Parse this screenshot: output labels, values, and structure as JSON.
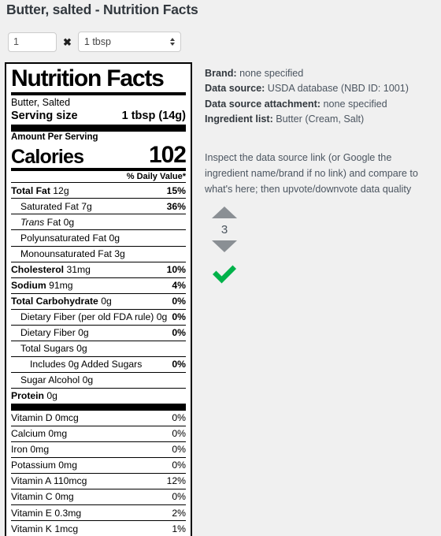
{
  "page": {
    "title": "Butter, salted - Nutrition Facts"
  },
  "serving_controls": {
    "quantity_value": "1",
    "quantity_placeholder": "1",
    "multiply_symbol": "✖",
    "unit_selected": "1 tbsp"
  },
  "label": {
    "heading": "Nutrition Facts",
    "description": "Butter, Salted",
    "serving_size_label": "Serving size",
    "serving_size_value": "1 tbsp (14g)",
    "amount_per_serving": "Amount Per Serving",
    "calories_label": "Calories",
    "calories_value": "102",
    "daily_value_header": "% Daily Value*",
    "rows": [
      {
        "name": "Total Fat",
        "amount": "12g",
        "dv": "15%",
        "bold": true,
        "indent": 0,
        "italic_word": ""
      },
      {
        "name": "Saturated Fat",
        "amount": "7g",
        "dv": "36%",
        "bold": false,
        "indent": 1,
        "italic_word": ""
      },
      {
        "name": "Trans Fat",
        "amount": "0g",
        "dv": "",
        "bold": false,
        "indent": 1,
        "italic_word": "Trans"
      },
      {
        "name": "Polyunsaturated Fat",
        "amount": "0g",
        "dv": "",
        "bold": false,
        "indent": 1,
        "italic_word": ""
      },
      {
        "name": "Monounsaturated Fat",
        "amount": "3g",
        "dv": "",
        "bold": false,
        "indent": 1,
        "italic_word": ""
      },
      {
        "name": "Cholesterol",
        "amount": "31mg",
        "dv": "10%",
        "bold": true,
        "indent": 0,
        "italic_word": ""
      },
      {
        "name": "Sodium",
        "amount": "91mg",
        "dv": "4%",
        "bold": true,
        "indent": 0,
        "italic_word": ""
      },
      {
        "name": "Total Carbohydrate",
        "amount": "0g",
        "dv": "0%",
        "bold": true,
        "indent": 0,
        "italic_word": ""
      },
      {
        "name": "Dietary Fiber (per old FDA rule)",
        "amount": "0g",
        "dv": "0%",
        "bold": false,
        "indent": 1,
        "italic_word": ""
      },
      {
        "name": "Dietary Fiber",
        "amount": "0g",
        "dv": "0%",
        "bold": false,
        "indent": 1,
        "italic_word": ""
      },
      {
        "name": "Total Sugars",
        "amount": "0g",
        "dv": "",
        "bold": false,
        "indent": 1,
        "italic_word": ""
      },
      {
        "name": "Includes 0g Added Sugars",
        "amount": "",
        "dv": "0%",
        "bold": false,
        "indent": 2,
        "italic_word": ""
      },
      {
        "name": "Sugar Alcohol",
        "amount": "0g",
        "dv": "",
        "bold": false,
        "indent": 1,
        "italic_word": ""
      },
      {
        "name": "Protein",
        "amount": "0g",
        "dv": "",
        "bold": true,
        "indent": 0,
        "italic_word": ""
      }
    ],
    "micronutrients": [
      {
        "name": "Vitamin D 0mcg",
        "dv": "0%"
      },
      {
        "name": "Calcium 0mg",
        "dv": "0%"
      },
      {
        "name": "Iron 0mg",
        "dv": "0%"
      },
      {
        "name": "Potassium 0mg",
        "dv": "0%"
      },
      {
        "name": "Vitamin A 110mcg",
        "dv": "12%"
      },
      {
        "name": "Vitamin C 0mg",
        "dv": "0%"
      },
      {
        "name": "Vitamin E 0.3mg",
        "dv": "2%"
      },
      {
        "name": "Vitamin K 1mcg",
        "dv": "1%"
      }
    ]
  },
  "meta": {
    "brand_key": "Brand:",
    "brand_value": "none specified",
    "data_source_key": "Data source:",
    "data_source_value": "USDA database (NBD ID: 1001)",
    "attachment_key": "Data source attachment:",
    "attachment_value": "none specified",
    "ingredient_key": "Ingredient list:",
    "ingredient_value": "Butter (Cream, Salt)"
  },
  "hint": {
    "text": "Inspect the data source link (or Google the ingredient name/brand if no link) and compare to what's here; then upvote/downvote data quality"
  },
  "vote": {
    "score": "3"
  },
  "colors": {
    "page_background": "#f0f0f0",
    "label_border": "#000000",
    "vote_arrow": "#8a8f94",
    "verified_green": "#00b24a",
    "title_text": "#32383e"
  }
}
